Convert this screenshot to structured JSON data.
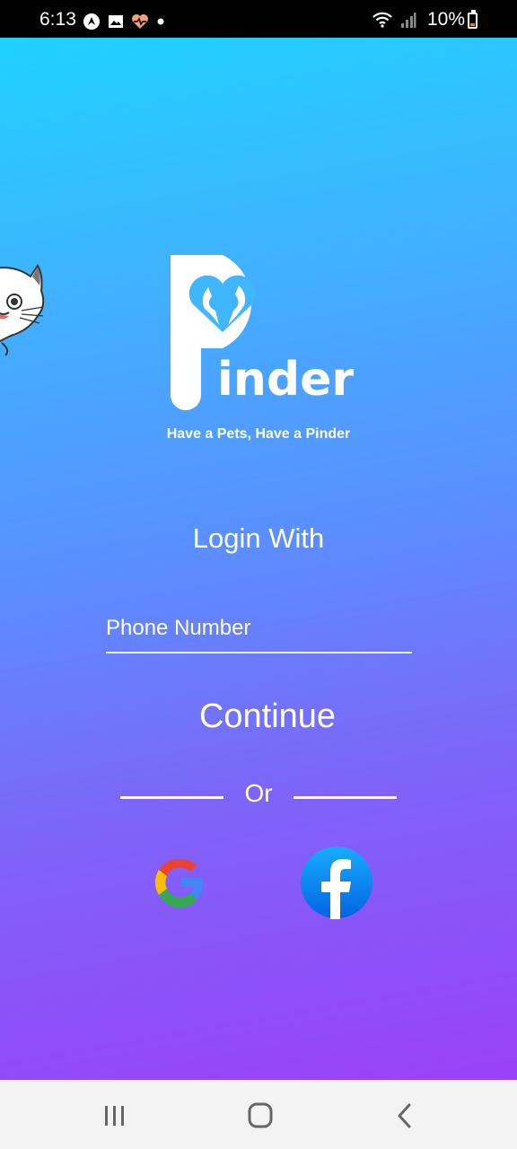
{
  "status_bar": {
    "time": "6:13",
    "battery": "10%",
    "icons_left": [
      "nav-app-icon",
      "gallery-icon",
      "health-icon",
      "dot-icon"
    ],
    "icons_right": [
      "wifi-icon",
      "signal-icon",
      "battery-icon"
    ]
  },
  "logo": {
    "letter": "P",
    "wordmark": "inder",
    "tagline": "Have a Pets, Have a Pinder"
  },
  "login": {
    "title": "Login With",
    "phone_placeholder": "Phone Number",
    "continue_label": "Continue",
    "divider_text": "Or"
  },
  "social": [
    "google-icon",
    "facebook-icon"
  ],
  "nav": [
    "recents-icon",
    "home-icon",
    "back-icon"
  ],
  "colors": {
    "gradient_top": "#1fd2ff",
    "gradient_bottom": "#9a41f7",
    "facebook_blue": "#1877f2"
  }
}
